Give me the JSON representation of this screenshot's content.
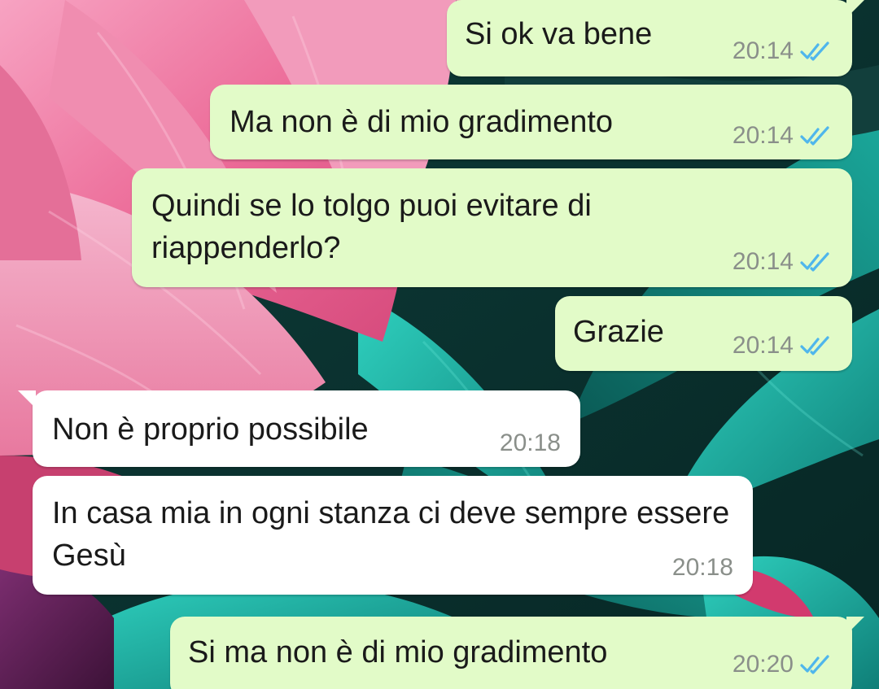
{
  "colors": {
    "outgoing_bubble": "#e2fbc8",
    "incoming_bubble": "#ffffff",
    "read_ticks": "#4fb6ec",
    "timestamp": "#8a8f8a",
    "message_text": "#1a1a1a"
  },
  "icons": {
    "read_receipt": "double-check-icon"
  },
  "messages": [
    {
      "direction": "outgoing",
      "text": "Si ok va bene",
      "time": "20:14",
      "status": "read"
    },
    {
      "direction": "outgoing",
      "text": "Ma non è di mio gradimento",
      "time": "20:14",
      "status": "read"
    },
    {
      "direction": "outgoing",
      "text": "Quindi se lo tolgo puoi evitare di riappenderlo?",
      "time": "20:14",
      "status": "read"
    },
    {
      "direction": "outgoing",
      "text": "Grazie",
      "time": "20:14",
      "status": "read"
    },
    {
      "direction": "incoming",
      "text": "Non è proprio possibile",
      "time": "20:18"
    },
    {
      "direction": "incoming",
      "text": "In casa mia in ogni stanza ci deve sempre essere Gesù",
      "time": "20:18"
    },
    {
      "direction": "outgoing",
      "text": "Si ma non è di mio gradimento",
      "time": "20:20",
      "status": "read"
    }
  ]
}
